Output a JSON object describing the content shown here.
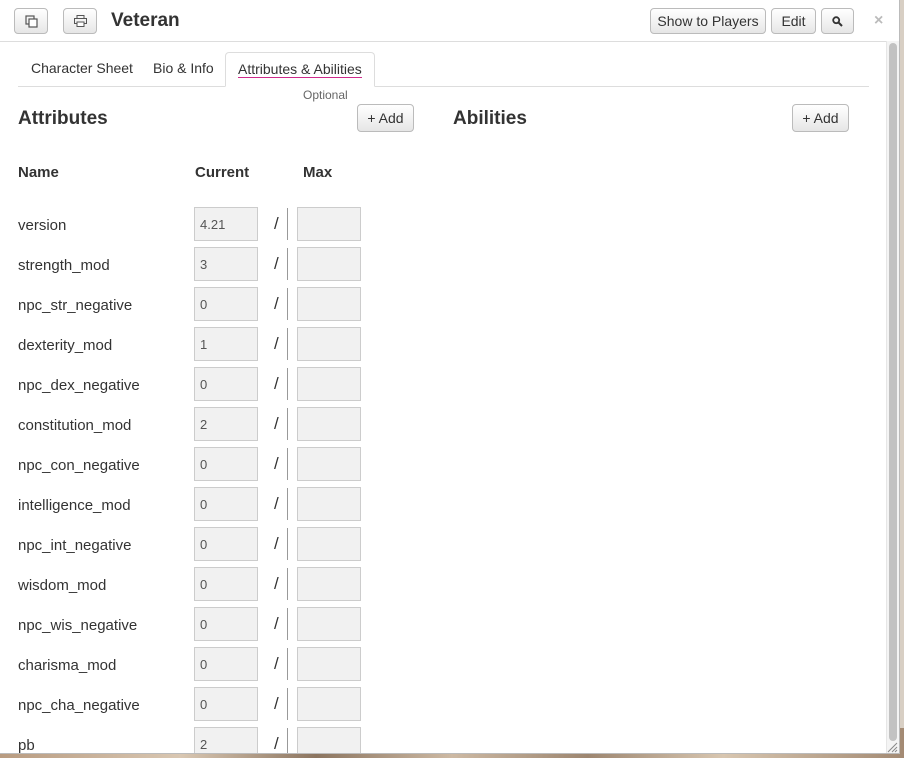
{
  "window": {
    "title": "Veteran",
    "show_to_players_label": "Show to Players",
    "edit_label": "Edit",
    "close_glyph": "×",
    "icons": [
      "popout-icon",
      "print-icon",
      "search-icon",
      "close-icon"
    ]
  },
  "tabs": [
    {
      "label": "Character Sheet",
      "active": false
    },
    {
      "label": "Bio & Info",
      "active": false
    },
    {
      "label": "Attributes & Abilities",
      "active": true
    }
  ],
  "attributes": {
    "title": "Attributes",
    "optional_label": "Optional",
    "add_label": "+ Add",
    "columns": {
      "name": "Name",
      "current": "Current",
      "max": "Max"
    },
    "separator": "/",
    "rows": [
      {
        "name": "version",
        "current": "4.21",
        "max": ""
      },
      {
        "name": "strength_mod",
        "current": "3",
        "max": ""
      },
      {
        "name": "npc_str_negative",
        "current": "0",
        "max": ""
      },
      {
        "name": "dexterity_mod",
        "current": "1",
        "max": ""
      },
      {
        "name": "npc_dex_negative",
        "current": "0",
        "max": ""
      },
      {
        "name": "constitution_mod",
        "current": "2",
        "max": ""
      },
      {
        "name": "npc_con_negative",
        "current": "0",
        "max": ""
      },
      {
        "name": "intelligence_mod",
        "current": "0",
        "max": ""
      },
      {
        "name": "npc_int_negative",
        "current": "0",
        "max": ""
      },
      {
        "name": "wisdom_mod",
        "current": "0",
        "max": ""
      },
      {
        "name": "npc_wis_negative",
        "current": "0",
        "max": ""
      },
      {
        "name": "charisma_mod",
        "current": "0",
        "max": ""
      },
      {
        "name": "npc_cha_negative",
        "current": "0",
        "max": ""
      },
      {
        "name": "pb",
        "current": "2",
        "max": ""
      }
    ]
  },
  "abilities": {
    "title": "Abilities",
    "add_label": "+ Add"
  },
  "colors": {
    "tab_underline": "#d02a8c",
    "input_bg": "#f1f1f1",
    "button_border": "#bbbbbb"
  }
}
